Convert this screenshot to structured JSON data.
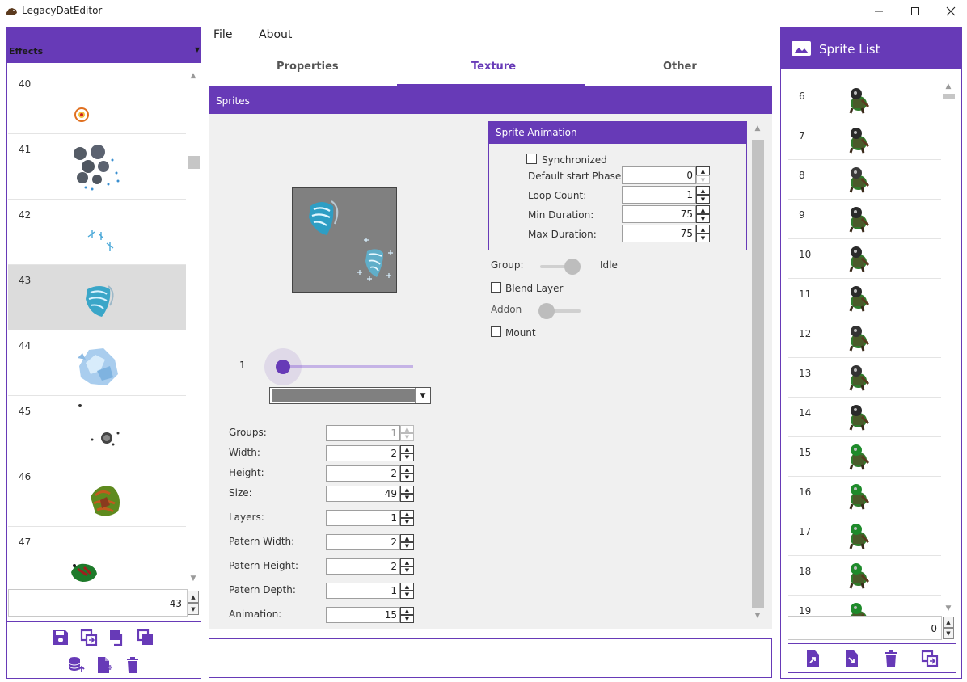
{
  "window": {
    "title": "LegacyDatEditor"
  },
  "left_panel": {
    "category": "Effects",
    "items": [
      {
        "id": "40"
      },
      {
        "id": "41"
      },
      {
        "id": "42"
      },
      {
        "id": "43"
      },
      {
        "id": "44"
      },
      {
        "id": "45"
      },
      {
        "id": "46"
      },
      {
        "id": "47"
      }
    ],
    "selected_id": "43",
    "number_value": "43"
  },
  "menu": {
    "file": "File",
    "about": "About"
  },
  "tabs": [
    {
      "label": "Properties"
    },
    {
      "label": "Texture",
      "active": true
    },
    {
      "label": "Other"
    }
  ],
  "sprites": {
    "header": "Sprites",
    "frame_value": "1",
    "properties": [
      {
        "label": "Groups:",
        "value": "1",
        "disabled": true
      },
      {
        "label": "Width:",
        "value": "2"
      },
      {
        "label": "Height:",
        "value": "2"
      },
      {
        "label": "Size:",
        "value": "49"
      },
      {
        "label": "Layers:",
        "value": "1"
      },
      {
        "label": "Patern Width:",
        "value": "2"
      },
      {
        "label": "Patern Height:",
        "value": "2"
      },
      {
        "label": "Patern Depth:",
        "value": "1"
      },
      {
        "label": "Animation:",
        "value": "15"
      }
    ]
  },
  "animation": {
    "header": "Sprite Animation",
    "synchronized_label": "Synchronized",
    "fields": [
      {
        "label": "Default start Phase:",
        "value": "0"
      },
      {
        "label": "Loop Count:",
        "value": "1"
      },
      {
        "label": "Min Duration:",
        "value": "75"
      },
      {
        "label": "Max Duration:",
        "value": "75"
      }
    ],
    "group_label": "Group:",
    "group_value": "Idle",
    "blend_layer_label": "Blend Layer",
    "addon_label": "Addon",
    "mount_label": "Mount"
  },
  "right_panel": {
    "title": "Sprite List",
    "items": [
      {
        "id": "6"
      },
      {
        "id": "7"
      },
      {
        "id": "8"
      },
      {
        "id": "9"
      },
      {
        "id": "10"
      },
      {
        "id": "11"
      },
      {
        "id": "12"
      },
      {
        "id": "13"
      },
      {
        "id": "14"
      },
      {
        "id": "15"
      },
      {
        "id": "16"
      },
      {
        "id": "17"
      },
      {
        "id": "18"
      },
      {
        "id": "19"
      }
    ],
    "number_value": "0"
  },
  "colors": {
    "accent": "#673ab7",
    "selection": "#dcdcdc",
    "panel_bg": "#f0f0f0"
  }
}
